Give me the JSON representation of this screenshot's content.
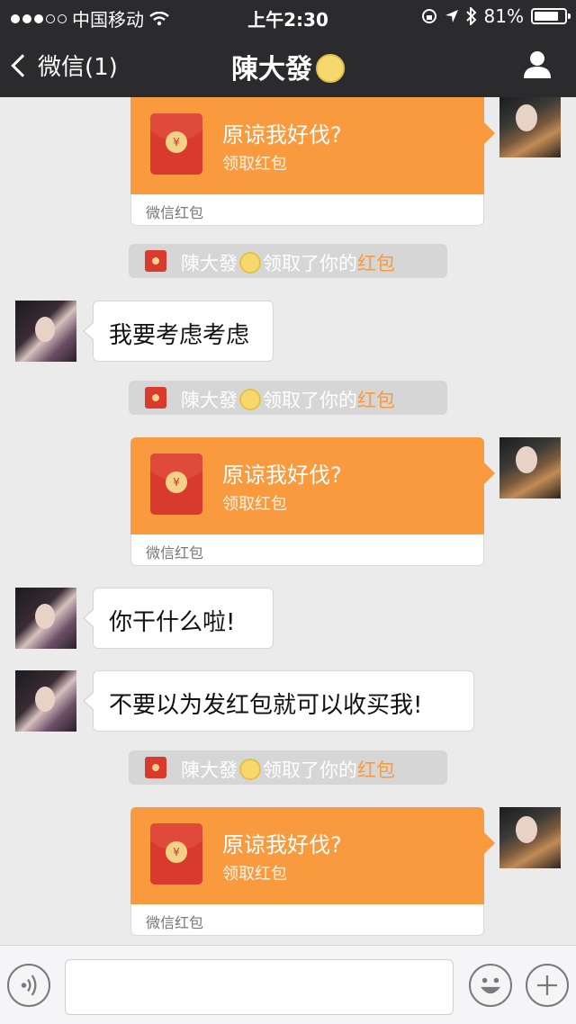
{
  "status_bar": {
    "carrier": "中国移动",
    "time": "上午2:30",
    "battery": "81%",
    "battery_level": 0.81
  },
  "nav": {
    "back_label": "微信(1)",
    "title": "陳大發"
  },
  "red_packet": {
    "greeting": "原谅我好伐?",
    "action": "领取红包",
    "brand": "微信红包"
  },
  "notice": {
    "name": "陳大發",
    "mid": "领取了你的",
    "highlight": "红包"
  },
  "messages": [
    {
      "text": "我要考虑考虑"
    },
    {
      "text": "你干什么啦!"
    },
    {
      "text": "不要以为发红包就可以收买我!"
    }
  ],
  "colors": {
    "nav_bg": "#2b2b2e",
    "chat_bg": "#ebebeb",
    "red_packet": "#f99a3e",
    "envelope": "#d83a2e",
    "highlight": "#f99a3e"
  }
}
